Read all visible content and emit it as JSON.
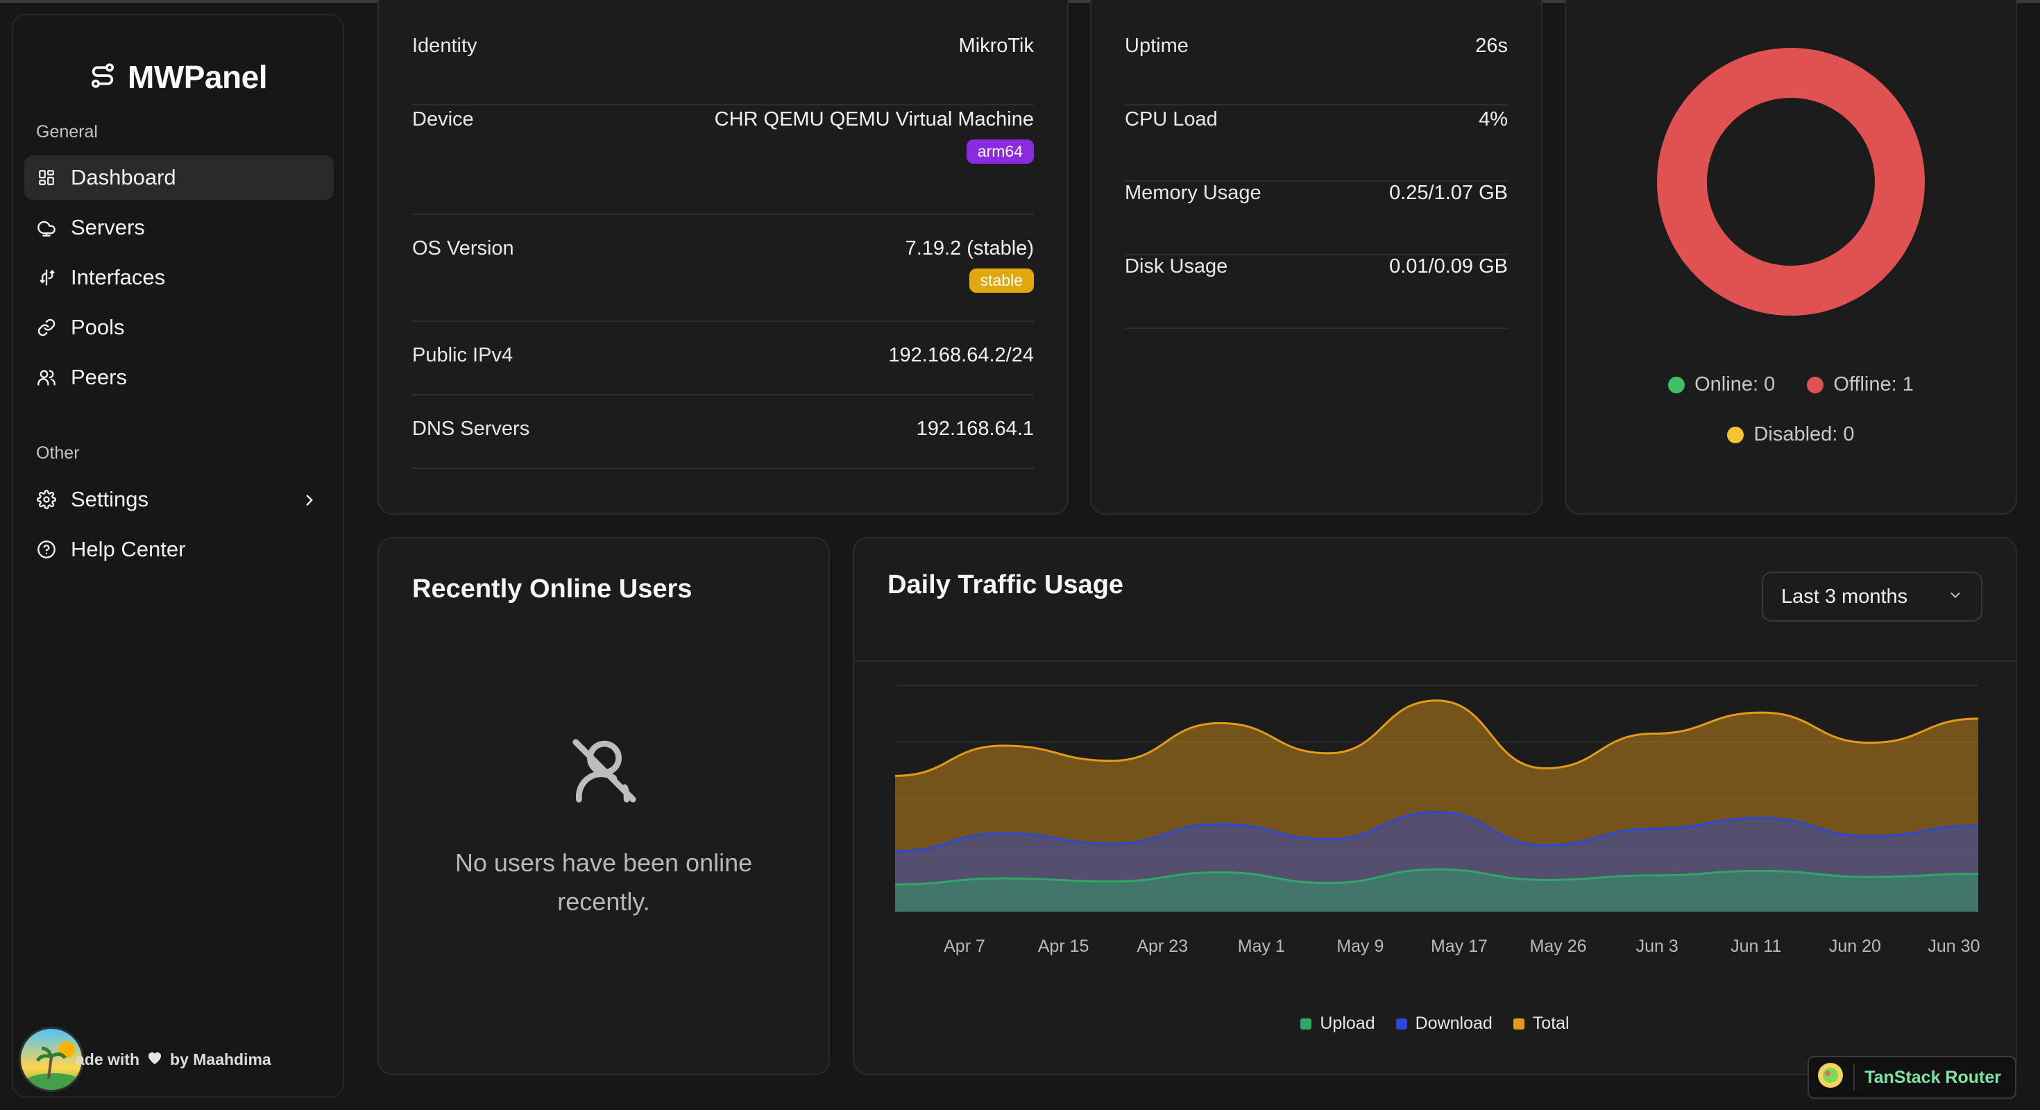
{
  "app": {
    "name": "MWPanel"
  },
  "sidebar": {
    "groups": [
      {
        "label": "General"
      },
      {
        "label": "Other"
      }
    ],
    "items": [
      {
        "label": "Dashboard",
        "icon": "dashboard-grid-icon",
        "active": true
      },
      {
        "label": "Servers",
        "icon": "cloud-icon"
      },
      {
        "label": "Interfaces",
        "icon": "route-icon"
      },
      {
        "label": "Pools",
        "icon": "link-icon"
      },
      {
        "label": "Peers",
        "icon": "users-icon"
      },
      {
        "label": "Settings",
        "icon": "gear-icon"
      },
      {
        "label": "Help Center",
        "icon": "help-circle-icon"
      }
    ],
    "footer": {
      "prefix": "ade with",
      "by": "by Maahdima"
    }
  },
  "identity_card": {
    "rows": [
      {
        "label": "Identity",
        "value": "MikroTik"
      },
      {
        "label": "Device",
        "value": "CHR QEMU QEMU Virtual Machine",
        "badge": "arm64"
      },
      {
        "label": "OS Version",
        "value": "7.19.2 (stable)",
        "badge": "stable"
      },
      {
        "label": "Public IPv4",
        "value": "192.168.64.2/24"
      },
      {
        "label": "DNS Servers",
        "value": "192.168.64.1"
      }
    ]
  },
  "resources_card": {
    "rows": [
      {
        "label": "Uptime",
        "value": "26s"
      },
      {
        "label": "CPU Load",
        "value": "4%"
      },
      {
        "label": "Memory Usage",
        "value": "0.25/1.07 GB"
      },
      {
        "label": "Disk Usage",
        "value": "0.01/0.09 GB"
      }
    ]
  },
  "status_card": {
    "online": "Online: 0",
    "offline": "Offline: 1",
    "disabled": "Disabled: 0",
    "counts": {
      "online": 0,
      "offline": 1,
      "disabled": 0
    },
    "colors": {
      "online": "#3fbf63",
      "offline": "#e05252",
      "disabled": "#f2c530"
    }
  },
  "recent_users": {
    "title": "Recently Online Users",
    "empty_line1": "No users have been online",
    "empty_line2": "recently."
  },
  "traffic": {
    "title": "Daily Traffic Usage",
    "range": "Last 3 months",
    "legend": {
      "upload": "Upload",
      "download": "Download",
      "total": "Total"
    },
    "colors": {
      "upload": "#2fa866",
      "download": "#2c48d6",
      "total": "#e39a1a"
    }
  },
  "chart_data": {
    "type": "area",
    "title": "Daily Traffic Usage",
    "categories": [
      "Apr 7",
      "Apr 15",
      "Apr 23",
      "May 1",
      "May 9",
      "May 17",
      "May 26",
      "Jun 3",
      "Jun 11",
      "Jun 20",
      "Jun 30"
    ],
    "series": [
      {
        "name": "Upload",
        "values": [
          18,
          22,
          20,
          26,
          19,
          28,
          21,
          24,
          27,
          23,
          25
        ]
      },
      {
        "name": "Download",
        "values": [
          40,
          52,
          45,
          58,
          48,
          66,
          44,
          55,
          62,
          50,
          57
        ]
      },
      {
        "name": "Total",
        "values": [
          90,
          110,
          100,
          125,
          105,
          140,
          95,
          118,
          132,
          112,
          128
        ]
      }
    ],
    "grid": true,
    "legend": "bottom"
  },
  "devtools": {
    "label": "TanStack Router"
  }
}
